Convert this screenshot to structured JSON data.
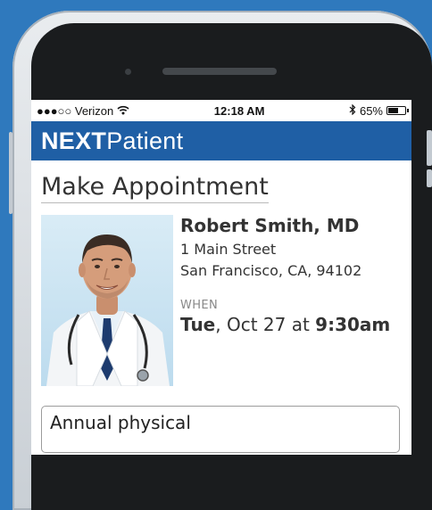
{
  "status_bar": {
    "signal_carrier": "●●●○○ Verizon",
    "time": "12:18 AM",
    "battery_percent": "65%",
    "battery_level": 0.65,
    "icons": [
      "wifi-icon",
      "bluetooth-icon",
      "battery-icon"
    ]
  },
  "app": {
    "brand_part1": "NEXT",
    "brand_part2": "Patient",
    "brand_color": "#1f5fa5"
  },
  "page": {
    "title": "Make Appointment"
  },
  "doctor": {
    "name": "Robert Smith, MD",
    "address_line1": "1 Main Street",
    "address_line2": "San Francisco, CA, 94102"
  },
  "appointment": {
    "when_label": "WHEN",
    "day": "Tue",
    "date_mid": ", Oct 27 at ",
    "time": "9:30am"
  },
  "reason": {
    "value": "Annual physical"
  },
  "colors": {
    "background": "#2f79bd",
    "appbar": "#1f5fa5"
  }
}
